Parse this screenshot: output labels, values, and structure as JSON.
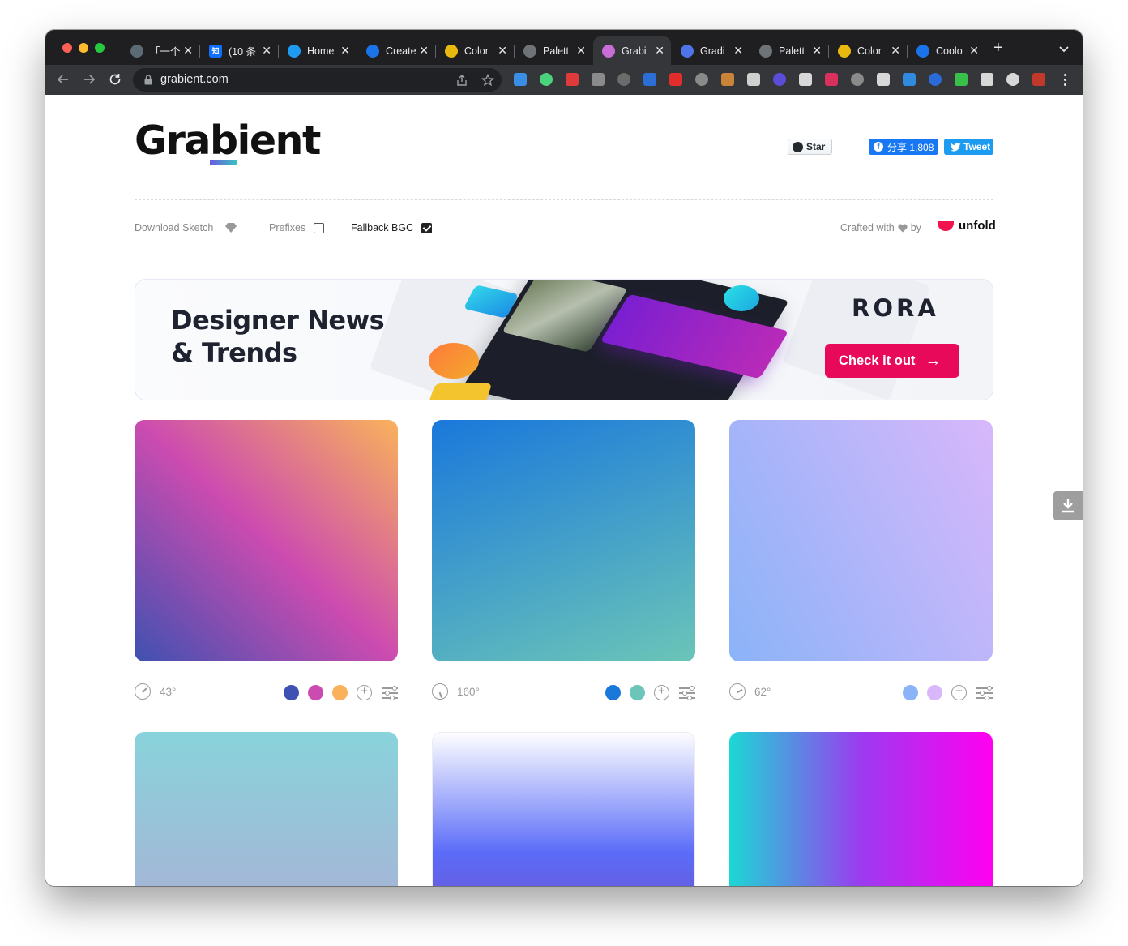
{
  "browser": {
    "tabs": [
      {
        "label": "「一个",
        "favicon": "openai-icon",
        "color": "#5c6a73"
      },
      {
        "label": "(10 条",
        "favicon": "zhihu-icon",
        "color": "#0f6fff",
        "glyph": "知"
      },
      {
        "label": "Home",
        "favicon": "twitter-icon",
        "color": "#1d9bf0"
      },
      {
        "label": "Create",
        "favicon": "google-icon",
        "color": "#1a73e8"
      },
      {
        "label": "Color",
        "favicon": "colorhunt-icon",
        "color": "#e8b90f"
      },
      {
        "label": "Palett",
        "favicon": "github-icon",
        "color": "#6e7378"
      },
      {
        "label": "Grabi",
        "favicon": "grabient-icon",
        "color": "#c86dd7",
        "active": true
      },
      {
        "label": "Gradi",
        "favicon": "uigradients-icon",
        "color": "#4f73e8"
      },
      {
        "label": "Palett",
        "favicon": "github-icon",
        "color": "#6e7378"
      },
      {
        "label": "Color",
        "favicon": "colorhunt-icon",
        "color": "#e8b90f"
      },
      {
        "label": "Coolo",
        "favicon": "coolors-icon",
        "color": "#1a73e8"
      }
    ],
    "url": "grabient.com",
    "extensions": [
      "#3a8ee6",
      "#4ad37a",
      "#e03b3b",
      "#8a8a8a",
      "#6b6b6b",
      "#2b6fd6",
      "#e22d2d",
      "#8a8a8a",
      "#c9843a",
      "#d0d0d0",
      "#5c4dd8",
      "#d8d8d8",
      "#d9305d",
      "#8a8a8a",
      "#d8d8d8",
      "#2f8ae0",
      "#2a6ad9",
      "#38c04a",
      "#d8d8d8",
      "#d8d8d8",
      "#c0392b"
    ]
  },
  "header": {
    "logo": "Grabient",
    "github_star": "Star",
    "fb_share": "分享 1,808",
    "tweet": "Tweet"
  },
  "options": {
    "download_sketch": "Download Sketch",
    "prefixes": "Prefixes",
    "prefixes_checked": false,
    "fallback_bgc": "Fallback BGC",
    "fallback_checked": true,
    "crafted_with": "Crafted with",
    "by": "by",
    "brand": "unfold"
  },
  "banner": {
    "title": "Designer News\n& Trends",
    "brand": "RORA",
    "cta": "Check it out"
  },
  "gradients": [
    {
      "angle": "43°",
      "angle_deg": 43,
      "colors": [
        "#3F51B1",
        "#CC4BB0",
        "#F9B25B"
      ]
    },
    {
      "angle": "160°",
      "angle_deg": 160,
      "colors": [
        "#1A78DB",
        "#6BC5B8"
      ]
    },
    {
      "angle": "62°",
      "angle_deg": 62,
      "colors": [
        "#8BB3F8",
        "#D8B7FB"
      ]
    },
    {
      "angle": "",
      "angle_deg": 180,
      "colors": [
        "#89D3DB",
        "#B2A8D4"
      ]
    },
    {
      "angle": "",
      "angle_deg": 180,
      "colors": [
        "#FFFFFF",
        "#5B6CF8",
        "#7A43B5"
      ]
    },
    {
      "angle": "",
      "angle_deg": 90,
      "colors": [
        "#1BD8D5",
        "#9B3BF0",
        "#FF00F0"
      ]
    }
  ]
}
